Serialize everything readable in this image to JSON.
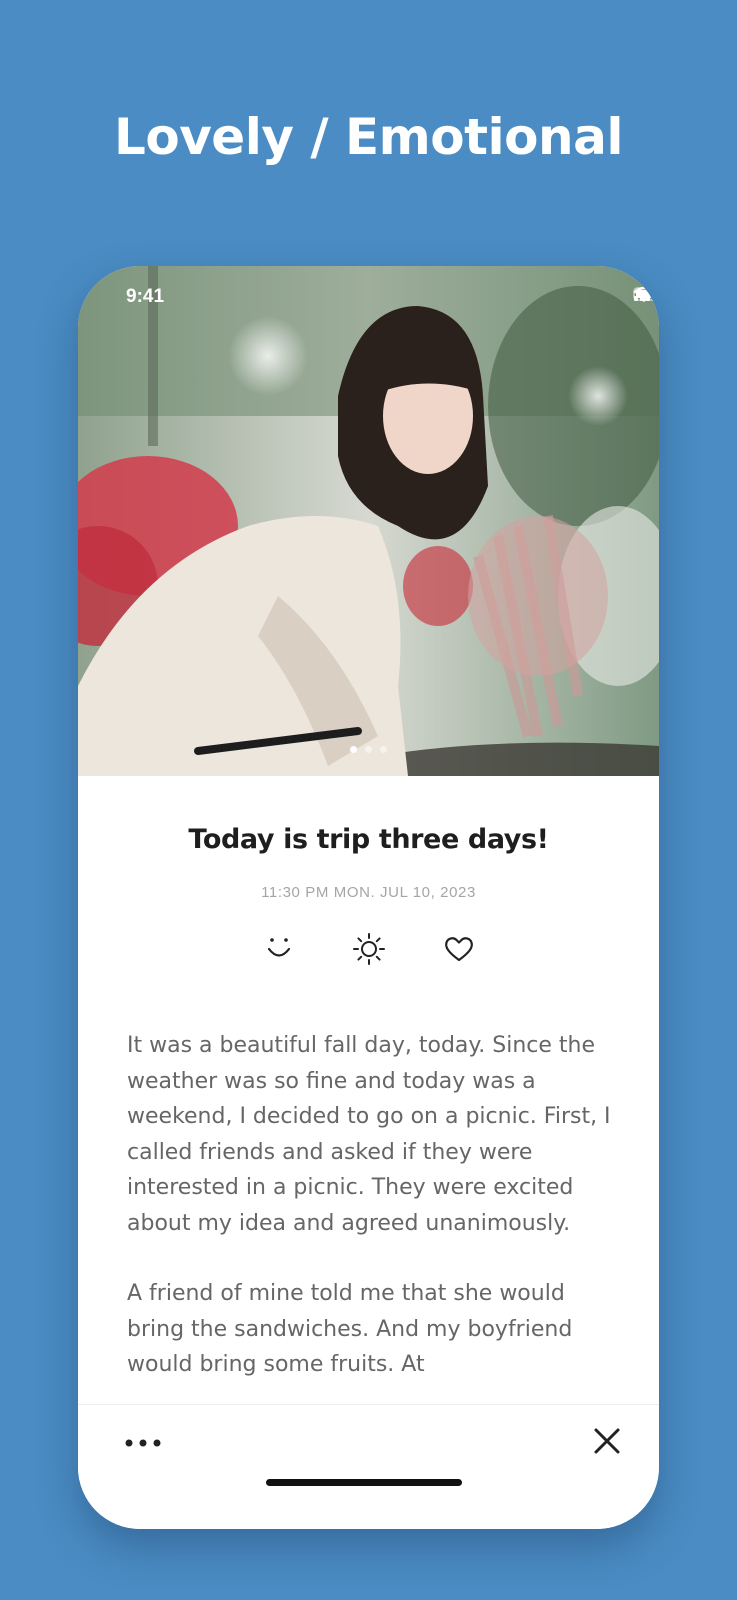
{
  "headline": "Lovely / Emotional",
  "status_bar": {
    "time": "9:41"
  },
  "photo": {
    "description_icon": "portrait-photo",
    "page_count": 3,
    "active_page": 1
  },
  "entry": {
    "title": "Today is trip three days!",
    "date": "11:30 PM  MON. JUL 10, 2023",
    "moods": [
      "smile-icon",
      "sun-icon",
      "heart-icon"
    ],
    "paragraphs": [
      "It was a beautiful fall day, today. Since the weather was so fine and today was a weekend, I decided to go on a picnic. First, I called friends and asked if they were interested in a picnic. They were excited about my idea and agreed unanimously.",
      "A friend of mine told me that she would bring the sandwiches. And my boyfriend would bring some fruits. At"
    ]
  },
  "toolbar": {
    "more_icon": "more-icon",
    "close_icon": "close-icon"
  }
}
